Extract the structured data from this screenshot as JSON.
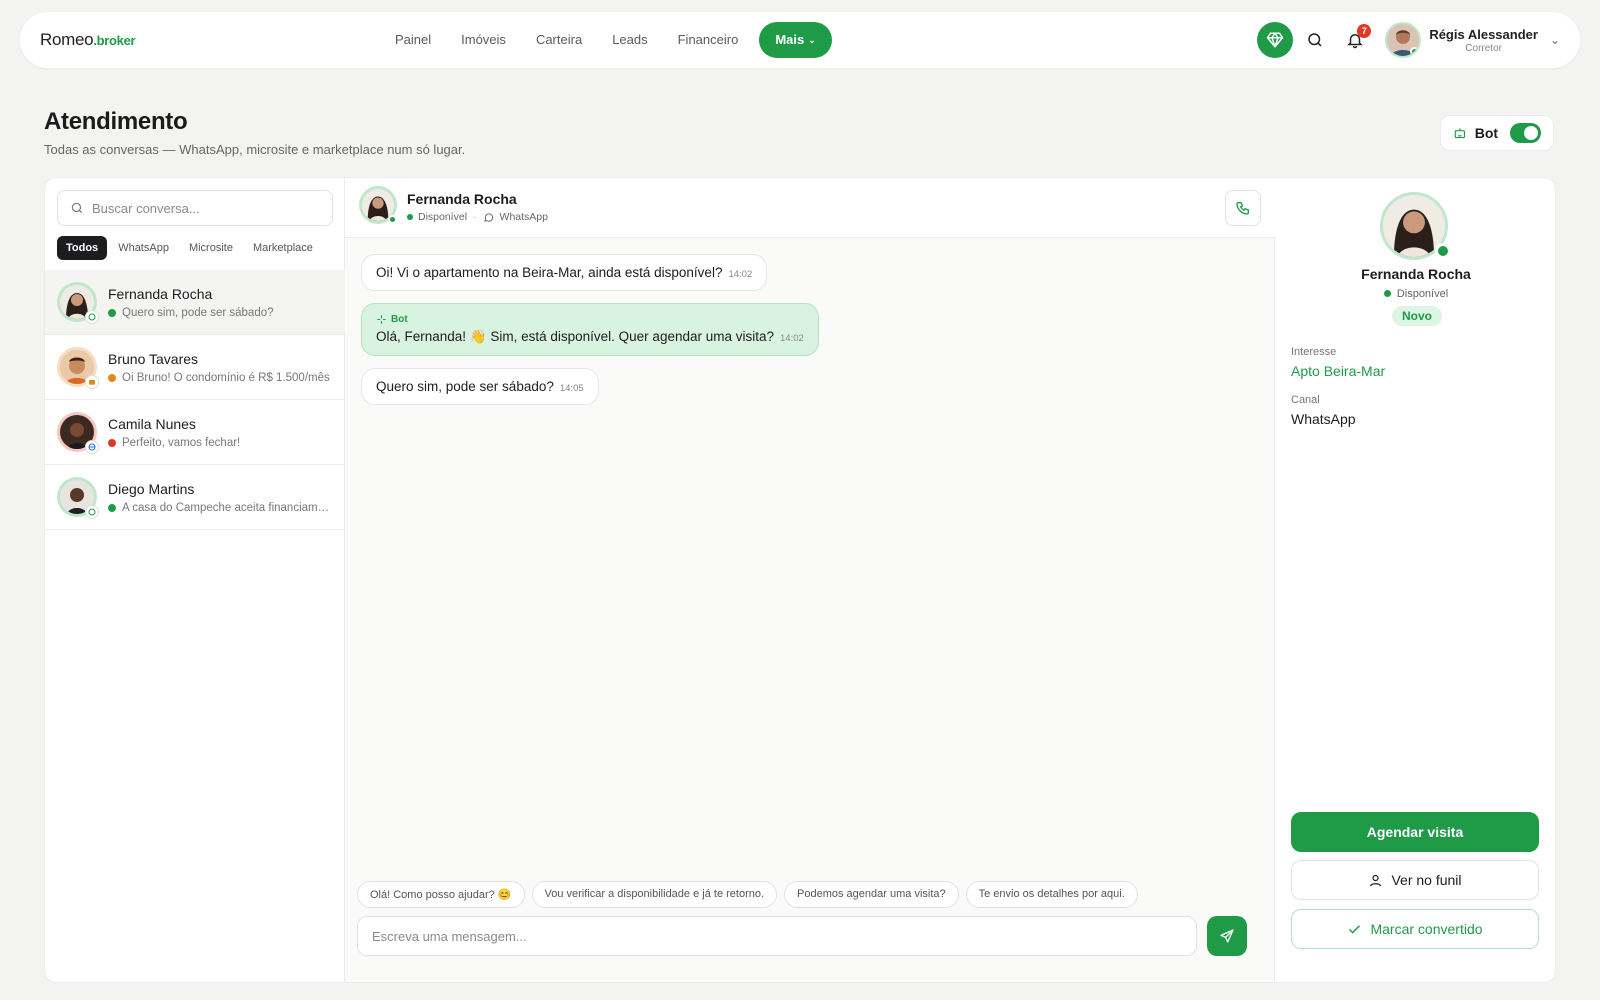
{
  "brand": {
    "name": "Romeo",
    "suffix": ".broker"
  },
  "nav": {
    "items": [
      "Painel",
      "Imóveis",
      "Carteira",
      "Leads",
      "Financeiro"
    ],
    "more_label": "Mais"
  },
  "user": {
    "name": "Régis Alessander",
    "role": "Corretor",
    "notifications": "7"
  },
  "page": {
    "title": "Atendimento",
    "subtitle": "Todas as conversas — WhatsApp, microsite e marketplace num só lugar.",
    "bot_label": "Bot",
    "bot_enabled": true
  },
  "list": {
    "search_placeholder": "Buscar conversa...",
    "filters": [
      "Todos",
      "WhatsApp",
      "Microsite",
      "Marketplace"
    ],
    "active_filter": "Todos",
    "conversations": [
      {
        "name": "Fernanda Rocha",
        "preview": "Quero sim, pode ser sábado?",
        "status_color": "#1f9b48",
        "channel": "whatsapp-icon",
        "ring": "#bfe7cb"
      },
      {
        "name": "Bruno Tavares",
        "preview": "Oi Bruno! O condomínio é R$ 1.500/mês",
        "status_color": "#e08a1e",
        "channel": "marketplace-icon",
        "ring": "#f6dcc0"
      },
      {
        "name": "Camila Nunes",
        "preview": "Perfeito, vamos fechar!",
        "status_color": "#e0392b",
        "channel": "globe-icon",
        "ring": "#f5c6c2"
      },
      {
        "name": "Diego Martins",
        "preview": "A casa do Campeche aceita financiamento?",
        "status_color": "#1f9b48",
        "channel": "whatsapp-icon",
        "ring": "#bfe7cb"
      }
    ]
  },
  "chat": {
    "contact": "Fernanda Rocha",
    "status": "Disponível",
    "channel": "WhatsApp",
    "messages": [
      {
        "from": "lead",
        "text": "Oi! Vi o apartamento na Beira-Mar, ainda está disponível?",
        "time": "14:02"
      },
      {
        "from": "bot",
        "tag": "Bot",
        "text": "Olá, Fernanda! 👋 Sim, está disponível. Quer agendar uma visita?",
        "time": "14:02"
      },
      {
        "from": "lead",
        "text": "Quero sim, pode ser sábado?",
        "time": "14:05"
      }
    ],
    "quick_replies": [
      "Olá! Como posso ajudar? 😊",
      "Vou verificar a disponibilidade e já te retorno.",
      "Podemos agendar uma visita?",
      "Te envio os detalhes por aqui."
    ],
    "compose_placeholder": "Escreva uma mensagem..."
  },
  "side": {
    "name": "Fernanda Rocha",
    "status": "Disponível",
    "stage": "Novo",
    "interest_label": "Interesse",
    "interest_value": "Apto Beira-Mar",
    "channel_label": "Canal",
    "channel_value": "WhatsApp",
    "btn_schedule": "Agendar visita",
    "btn_funnel": "Ver no funil",
    "btn_convert": "Marcar convertido"
  },
  "colors": {
    "accent": "#1f9b48",
    "accent_light": "#d8f3df",
    "alert": "#e0392b"
  }
}
